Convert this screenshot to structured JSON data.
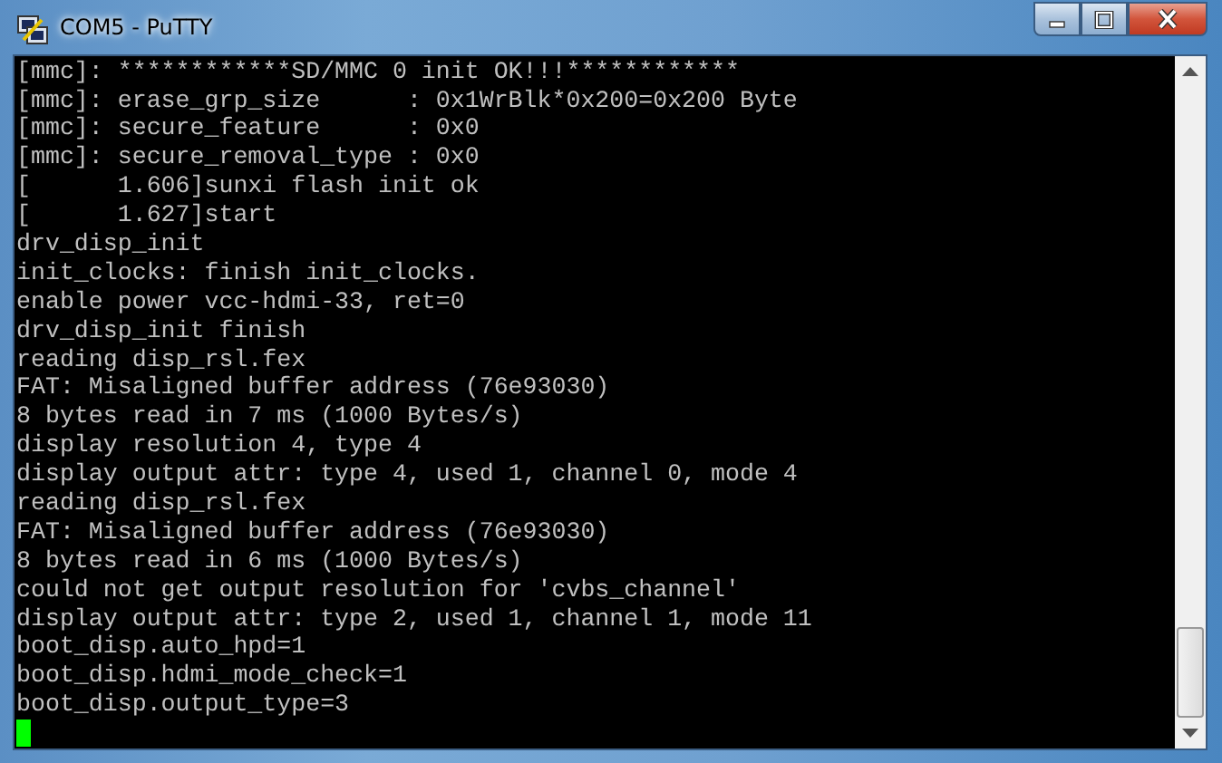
{
  "window": {
    "title": "COM5 - PuTTY"
  },
  "terminal": {
    "lines": [
      "[mmc]: ************SD/MMC 0 init OK!!!************",
      "[mmc]: erase_grp_size      : 0x1WrBlk*0x200=0x200 Byte",
      "[mmc]: secure_feature      : 0x0",
      "[mmc]: secure_removal_type : 0x0",
      "[      1.606]sunxi flash init ok",
      "[      1.627]start",
      "drv_disp_init",
      "init_clocks: finish init_clocks.",
      "enable power vcc-hdmi-33, ret=0",
      "drv_disp_init finish",
      "reading disp_rsl.fex",
      "FAT: Misaligned buffer address (76e93030)",
      "8 bytes read in 7 ms (1000 Bytes/s)",
      "display resolution 4, type 4",
      "display output attr: type 4, used 1, channel 0, mode 4",
      "reading disp_rsl.fex",
      "FAT: Misaligned buffer address (76e93030)",
      "8 bytes read in 6 ms (1000 Bytes/s)",
      "could not get output resolution for 'cvbs_channel'",
      "display output attr: type 2, used 1, channel 1, mode 11",
      "boot_disp.auto_hpd=1",
      "boot_disp.hdmi_mode_check=1",
      "boot_disp.output_type=3"
    ]
  }
}
